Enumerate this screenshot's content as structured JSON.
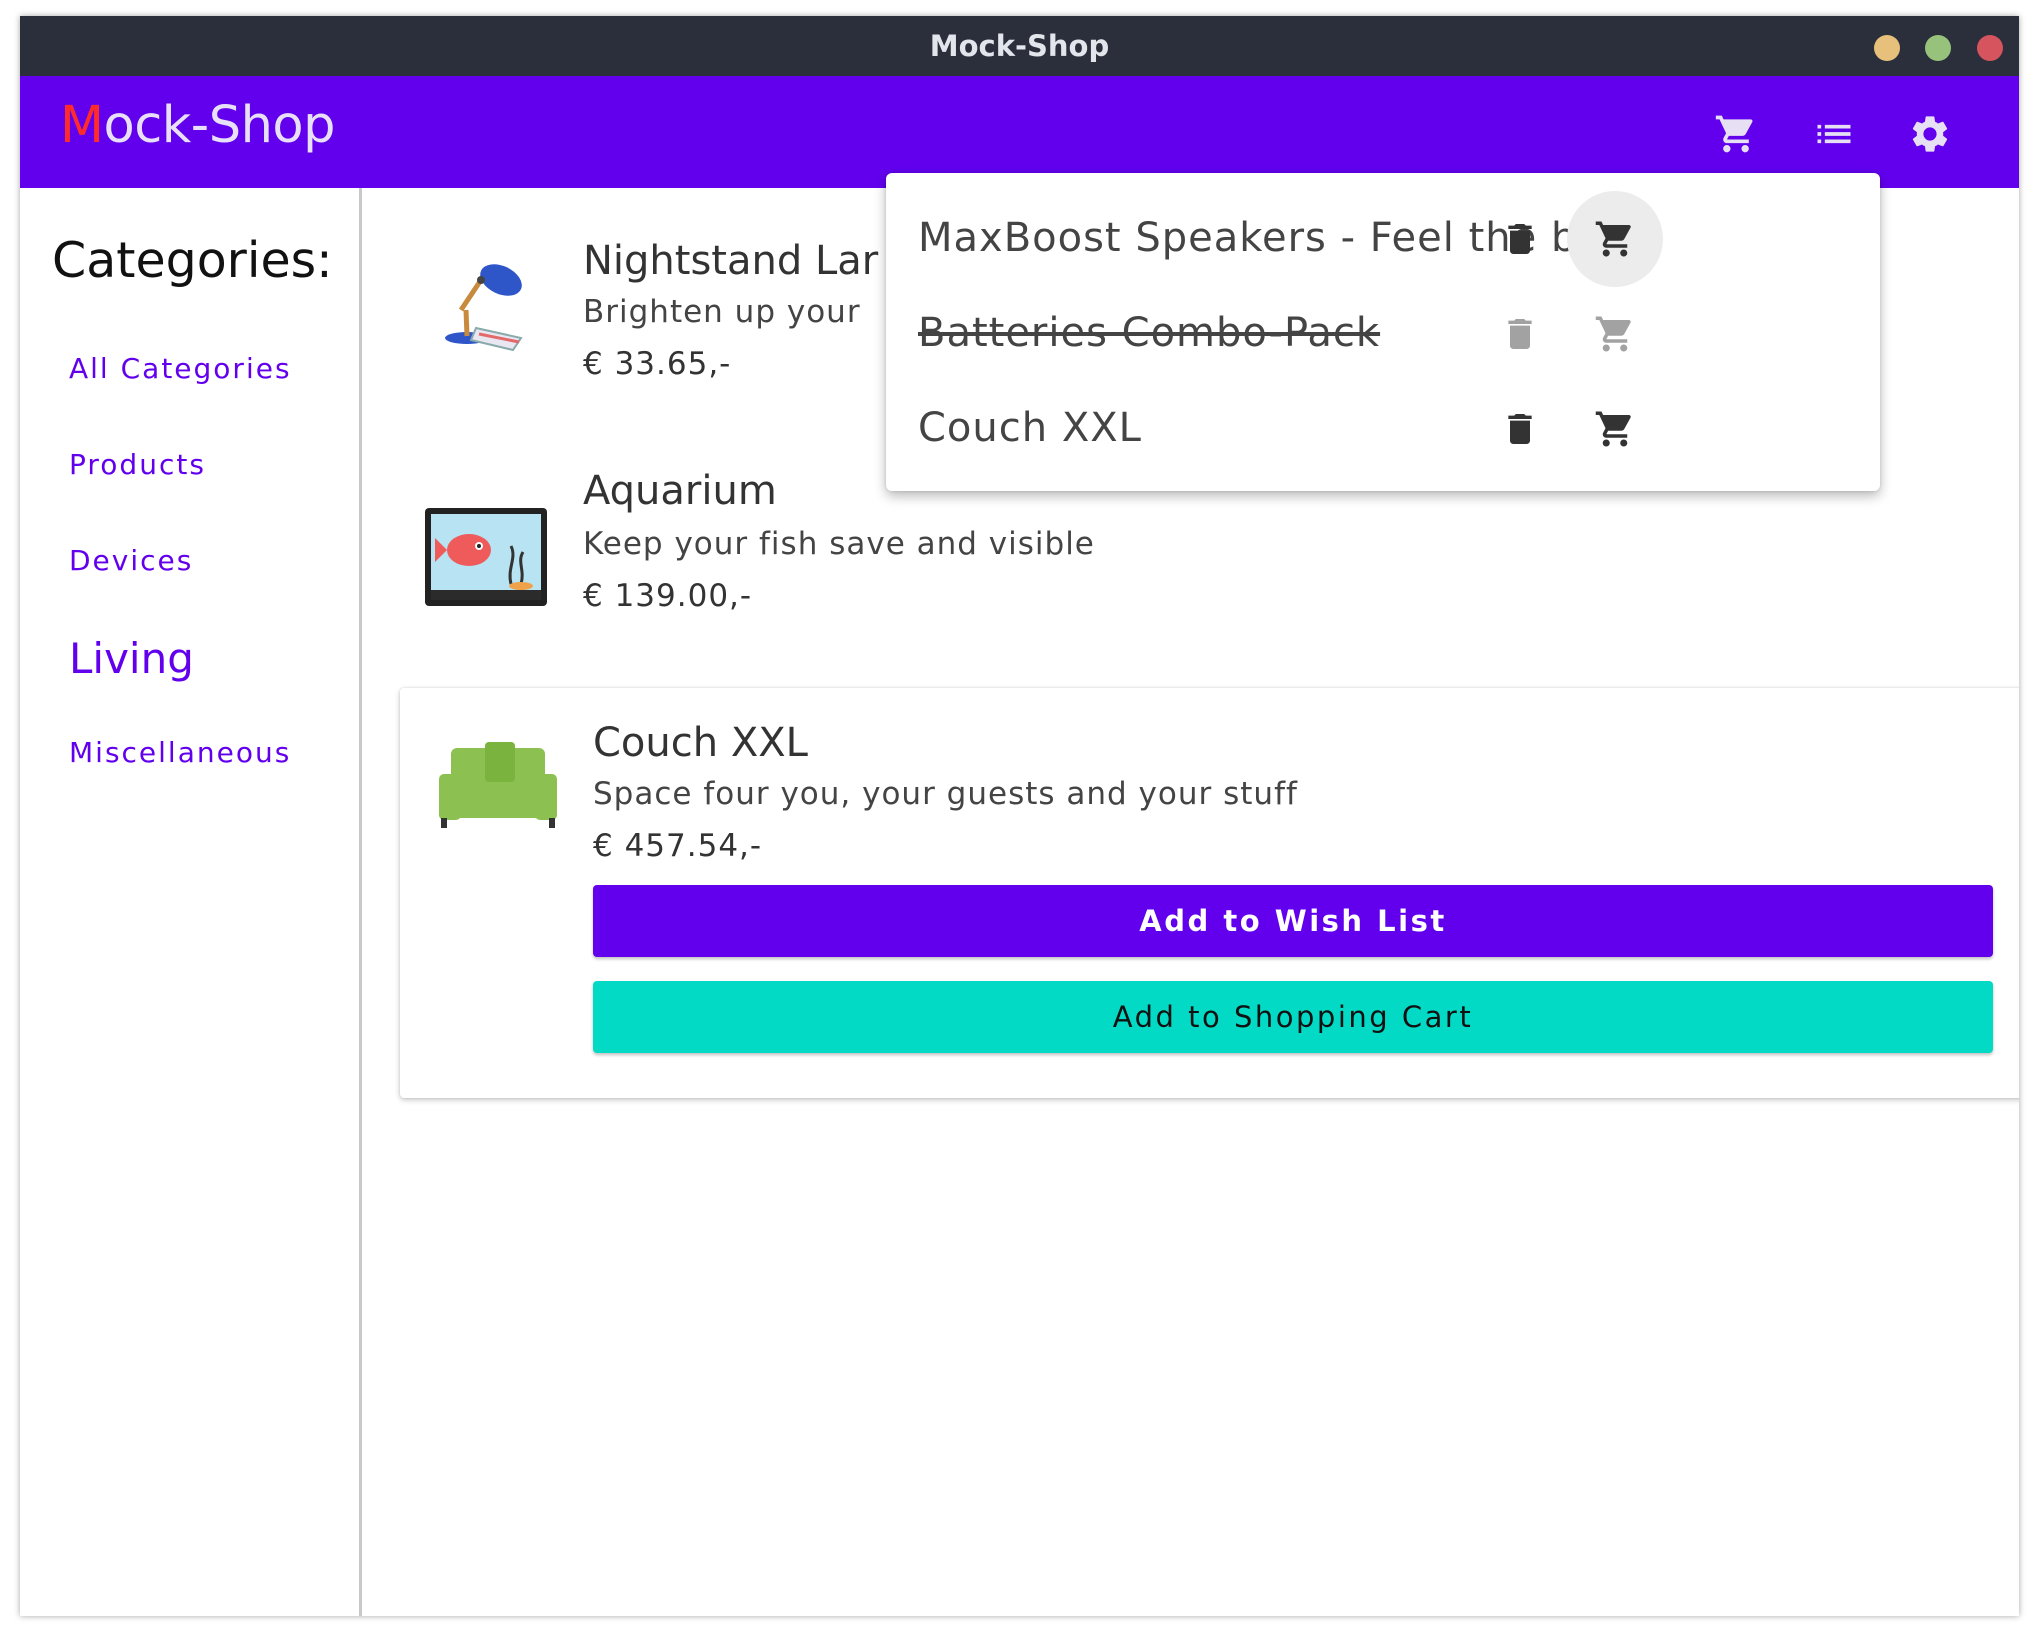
{
  "window": {
    "title": "Mock-Shop",
    "controls": {
      "minimize_color": "#e7c07b",
      "maximize_color": "#97c27c",
      "close_color": "#d5545d"
    }
  },
  "appbar": {
    "brand_first": "M",
    "brand_rest": "ock-Shop",
    "icons": [
      "shopping-cart-icon",
      "list-icon",
      "settings-gear-icon"
    ],
    "color": "#6200ee"
  },
  "sidebar": {
    "title": "Categories:",
    "items": [
      {
        "label": "All Categories",
        "active": false
      },
      {
        "label": "Products",
        "active": false
      },
      {
        "label": "Devices",
        "active": false
      },
      {
        "label": "Living",
        "active": true
      },
      {
        "label": "Miscellaneous",
        "active": false
      }
    ]
  },
  "products": [
    {
      "name": "Nightstand Lar",
      "description": "Brighten up your",
      "price": "€ 33.65,-",
      "icon": "desk-lamp-icon"
    },
    {
      "name": "Aquarium",
      "description": "Keep your fish save and visible",
      "price": "€ 139.00,-",
      "icon": "aquarium-icon"
    },
    {
      "name": "Couch XXL",
      "description": "Space four you, your guests and your stuff",
      "price": "€ 457.54,-",
      "icon": "couch-icon",
      "actions": {
        "wish": "Add to Wish List",
        "cart": "Add to Shopping Cart"
      }
    }
  ],
  "wishlist_popup": {
    "items": [
      {
        "name": "MaxBoost Speakers - Feel the bass!",
        "done": false
      },
      {
        "name": "Batteries Combo-Pack",
        "done": true
      },
      {
        "name": "Couch XXL",
        "done": false
      }
    ]
  },
  "colors": {
    "primary": "#6200ee",
    "secondary": "#03dac5",
    "brand_initial": "#ff2a2a"
  }
}
